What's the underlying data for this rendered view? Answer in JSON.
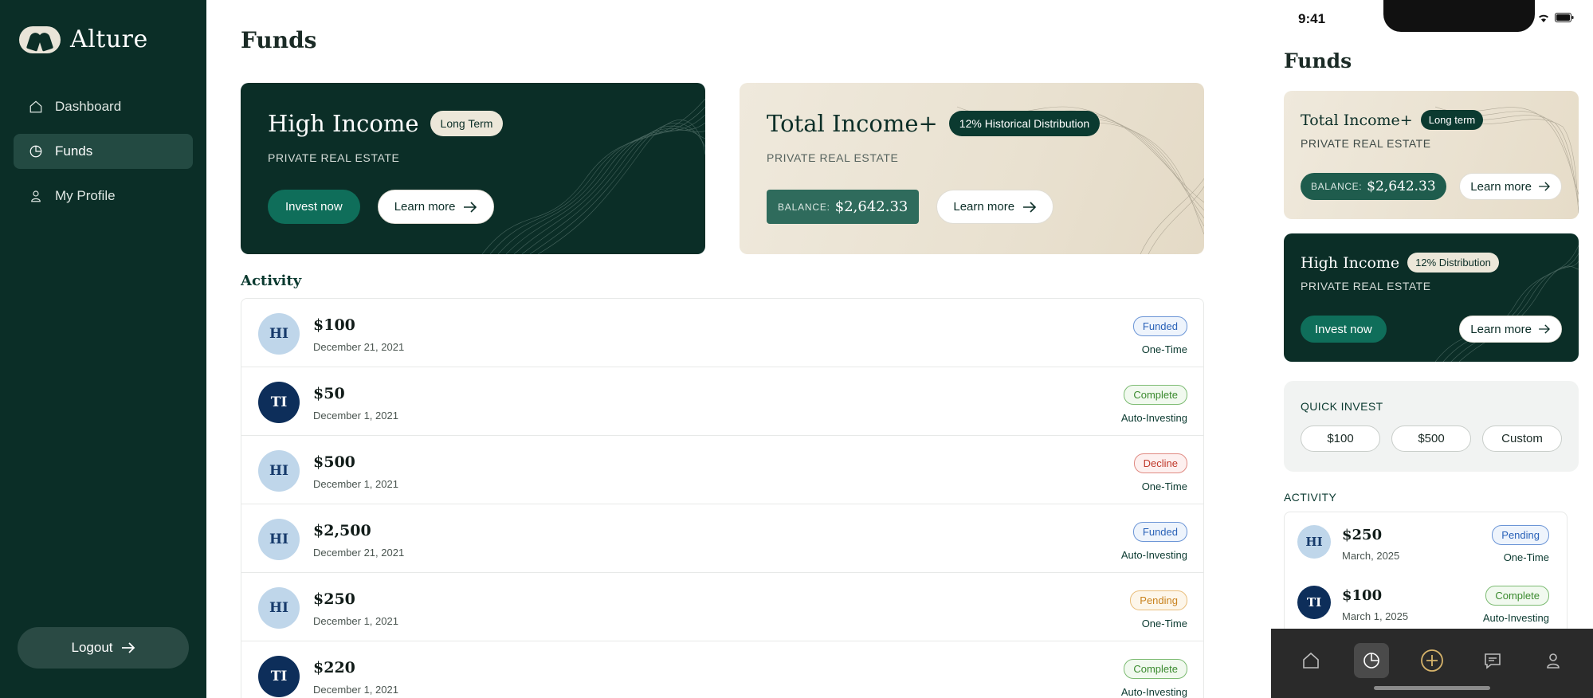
{
  "brand": {
    "name": "Alture"
  },
  "sidebar": {
    "items": [
      {
        "label": "Dashboard",
        "icon": "home-icon"
      },
      {
        "label": "Funds",
        "icon": "pie-chart-icon"
      },
      {
        "label": "My Profile",
        "icon": "user-icon"
      }
    ],
    "logout_label": "Logout"
  },
  "main": {
    "title": "Funds",
    "cards": [
      {
        "title": "High Income",
        "badge": "Long Term",
        "subtitle": "PRIVATE REAL ESTATE",
        "invest_label": "Invest now",
        "learn_label": "Learn more"
      },
      {
        "title": "Total Income+",
        "badge": "12% Historical Distribution",
        "subtitle": "PRIVATE REAL ESTATE",
        "balance_label": "BALANCE:",
        "balance_value": "$2,642.33",
        "learn_label": "Learn more"
      }
    ],
    "activity_title": "Activity",
    "activity": [
      {
        "initials": "HI",
        "amount": "$100",
        "date": "December 21, 2021",
        "status": "Funded",
        "frequency": "One-Time"
      },
      {
        "initials": "TI",
        "amount": "$50",
        "date": "December 1, 2021",
        "status": "Complete",
        "frequency": "Auto-Investing"
      },
      {
        "initials": "HI",
        "amount": "$500",
        "date": "December 1, 2021",
        "status": "Decline",
        "frequency": "One-Time"
      },
      {
        "initials": "HI",
        "amount": "$2,500",
        "date": "December 21, 2021",
        "status": "Funded",
        "frequency": "Auto-Investing"
      },
      {
        "initials": "HI",
        "amount": "$250",
        "date": "December 1, 2021",
        "status": "Pending",
        "frequency": "One-Time"
      },
      {
        "initials": "TI",
        "amount": "$220",
        "date": "December 1, 2021",
        "status": "Complete",
        "frequency": "Auto-Investing"
      }
    ]
  },
  "phone": {
    "time": "9:41",
    "title": "Funds",
    "cards": [
      {
        "title": "Total Income+",
        "badge": "Long term",
        "subtitle": "PRIVATE REAL ESTATE",
        "balance_label": "BALANCE:",
        "balance_value": "$2,642.33",
        "learn_label": "Learn more"
      },
      {
        "title": "High Income",
        "badge": "12% Distribution",
        "subtitle": "PRIVATE REAL ESTATE",
        "invest_label": "Invest now",
        "learn_label": "Learn more"
      }
    ],
    "quick_invest": {
      "title": "QUICK INVEST",
      "options": [
        "$100",
        "$500",
        "Custom"
      ]
    },
    "activity_title": "ACTIVITY",
    "activity": [
      {
        "initials": "HI",
        "amount": "$250",
        "date": "March, 2025",
        "status": "Pending",
        "frequency": "One-Time"
      },
      {
        "initials": "TI",
        "amount": "$100",
        "date": "March 1, 2025",
        "status": "Complete",
        "frequency": "Auto-Investing"
      }
    ],
    "tabs": [
      "home-icon",
      "pie-chart-icon",
      "plus-circle-icon",
      "chat-icon",
      "user-icon"
    ]
  },
  "colors": {
    "brand_dark": "#0b2e27",
    "accent_green": "#0f6e5a",
    "cream": "#efe9dc"
  }
}
